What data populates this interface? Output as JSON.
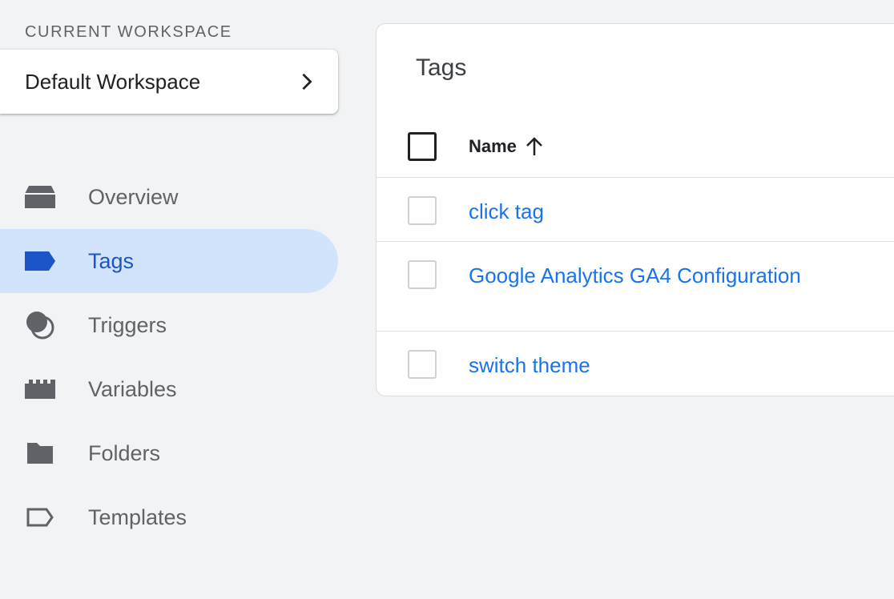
{
  "workspace": {
    "section_label": "CURRENT WORKSPACE",
    "name": "Default Workspace"
  },
  "nav": {
    "items": [
      {
        "label": "Overview",
        "icon": "overview-icon"
      },
      {
        "label": "Tags",
        "icon": "tag-icon",
        "active": true
      },
      {
        "label": "Triggers",
        "icon": "trigger-icon"
      },
      {
        "label": "Variables",
        "icon": "variable-icon"
      },
      {
        "label": "Folders",
        "icon": "folder-icon"
      },
      {
        "label": "Templates",
        "icon": "template-icon"
      }
    ]
  },
  "panel": {
    "title": "Tags",
    "column_name": "Name",
    "rows": [
      {
        "name": "click tag"
      },
      {
        "name": "Google Analytics GA4 Configuration"
      },
      {
        "name": "switch theme"
      }
    ]
  },
  "colors": {
    "accent": "#1a73e8",
    "active_nav_bg": "#d2e3fc",
    "background": "#f1f3f4"
  }
}
